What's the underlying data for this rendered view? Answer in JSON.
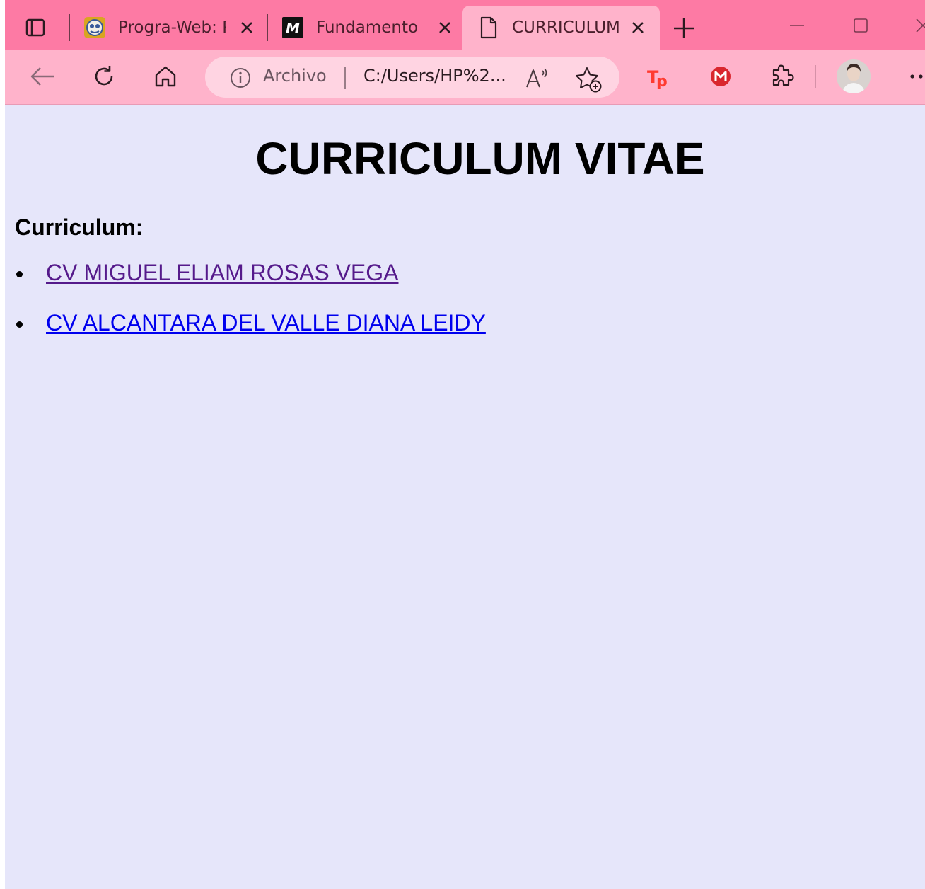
{
  "browser": {
    "tabs": [
      {
        "title": "Progra-Web: P",
        "icon": "moodle-icon",
        "active": false
      },
      {
        "title": "Fundamentos",
        "icon": "m-logo-icon",
        "active": false
      },
      {
        "title": "CURRICULUM",
        "icon": "document-icon",
        "active": true
      }
    ],
    "address": {
      "scheme_label": "Archivo",
      "url": "C:/Users/HP%2..."
    },
    "extensions": [
      "tp-extension-icon",
      "mega-extension-icon",
      "puzzle-extensions-icon"
    ],
    "colors": {
      "tabstrip": "#fd7aa4",
      "toolbar": "#ffb3cb",
      "page_background": "#e6e6fa"
    }
  },
  "page": {
    "title": "CURRICULUM VITAE",
    "section_heading": "Curriculum:",
    "links": [
      {
        "text": "CV MIGUEL ELIAM ROSAS VEGA",
        "visited": true
      },
      {
        "text": "CV ALCANTARA DEL VALLE DIANA LEIDY",
        "visited": false
      }
    ]
  }
}
